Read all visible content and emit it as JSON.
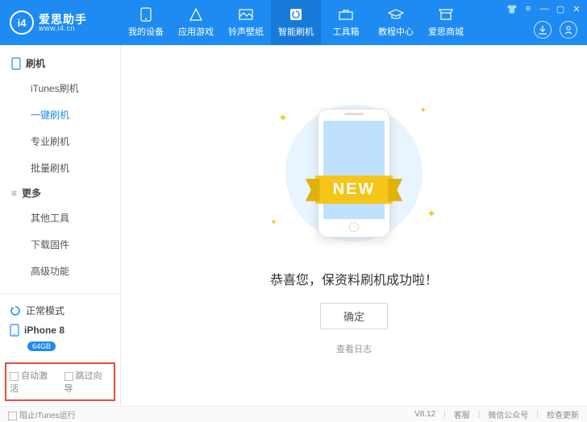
{
  "header": {
    "logo_badge": "i4",
    "logo_cn": "爱思助手",
    "logo_url": "www.i4.cn",
    "nav": [
      {
        "label": "我的设备"
      },
      {
        "label": "应用游戏"
      },
      {
        "label": "铃声壁纸"
      },
      {
        "label": "智能刷机"
      },
      {
        "label": "工具箱"
      },
      {
        "label": "教程中心"
      },
      {
        "label": "爱思商城"
      }
    ]
  },
  "sidebar": {
    "sec_flash": "刷机",
    "flash_items": [
      "iTunes刷机",
      "一键刷机",
      "专业刷机",
      "批量刷机"
    ],
    "sec_more": "更多",
    "more_items": [
      "其他工具",
      "下载固件",
      "高级功能"
    ],
    "mode": "正常模式",
    "device": "iPhone 8",
    "storage": "64GB",
    "opt_auto": "自动激活",
    "opt_skip": "跳过向导"
  },
  "main": {
    "ribbon": "NEW",
    "success": "恭喜您，保资料刷机成功啦！",
    "ok": "确定",
    "log": "查看日志"
  },
  "footer": {
    "block_itunes": "阻止iTunes运行",
    "version": "V8.12",
    "support": "客服",
    "wechat": "微信公众号",
    "update": "检查更新"
  }
}
